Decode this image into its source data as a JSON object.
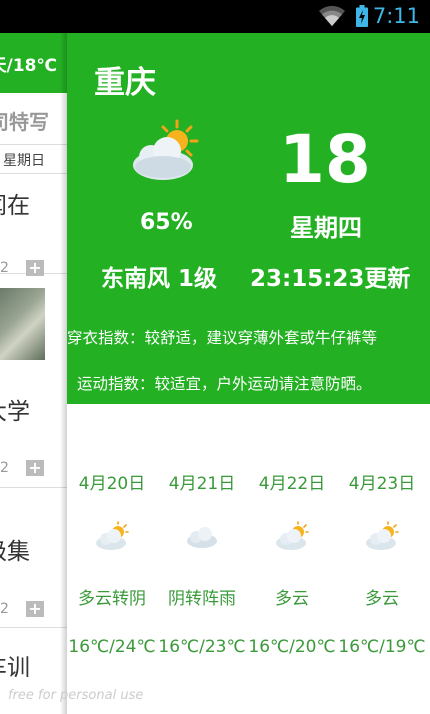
{
  "status_bar": {
    "time": "7:11",
    "wifi_icon": "wifi-icon",
    "battery_icon": "battery-icon"
  },
  "side_list": {
    "header": "天/18℃",
    "subtitle": "司特写",
    "date": "星期日",
    "items": [
      {
        "title": "闻在",
        "count": "2"
      },
      {
        "title": "大学",
        "count": "2"
      },
      {
        "title": "级集",
        "count": "2"
      },
      {
        "title": "车训"
      }
    ],
    "watermark": "free for personal use"
  },
  "weather": {
    "city": "重庆",
    "temperature": "18",
    "humidity": "65%",
    "weekday": "星期四",
    "wind": "东南风 1级",
    "updated": "23:15:23更新",
    "clothing_index": "穿衣指数：较舒适，建议穿薄外套或牛仔裤等",
    "sport_index": "运动指数：较适宜，户外运动请注意防晒。",
    "icon": "partly-cloudy-icon"
  },
  "forecast": [
    {
      "date": "4月20日",
      "condition": "多云转阴",
      "range": "16℃/24℃",
      "icon": "partly-cloudy-icon"
    },
    {
      "date": "4月21日",
      "condition": "阴转阵雨",
      "range": "16℃/23℃",
      "icon": "cloudy-icon"
    },
    {
      "date": "4月22日",
      "condition": "多云",
      "range": "16℃/20℃",
      "icon": "partly-cloudy-icon"
    },
    {
      "date": "4月23日",
      "condition": "多云",
      "range": "16℃/19℃",
      "icon": "partly-cloudy-icon"
    }
  ],
  "colors": {
    "accent_green": "#23b023",
    "forecast_text": "#3a9a3a",
    "status_blue": "#3fb6e8"
  }
}
